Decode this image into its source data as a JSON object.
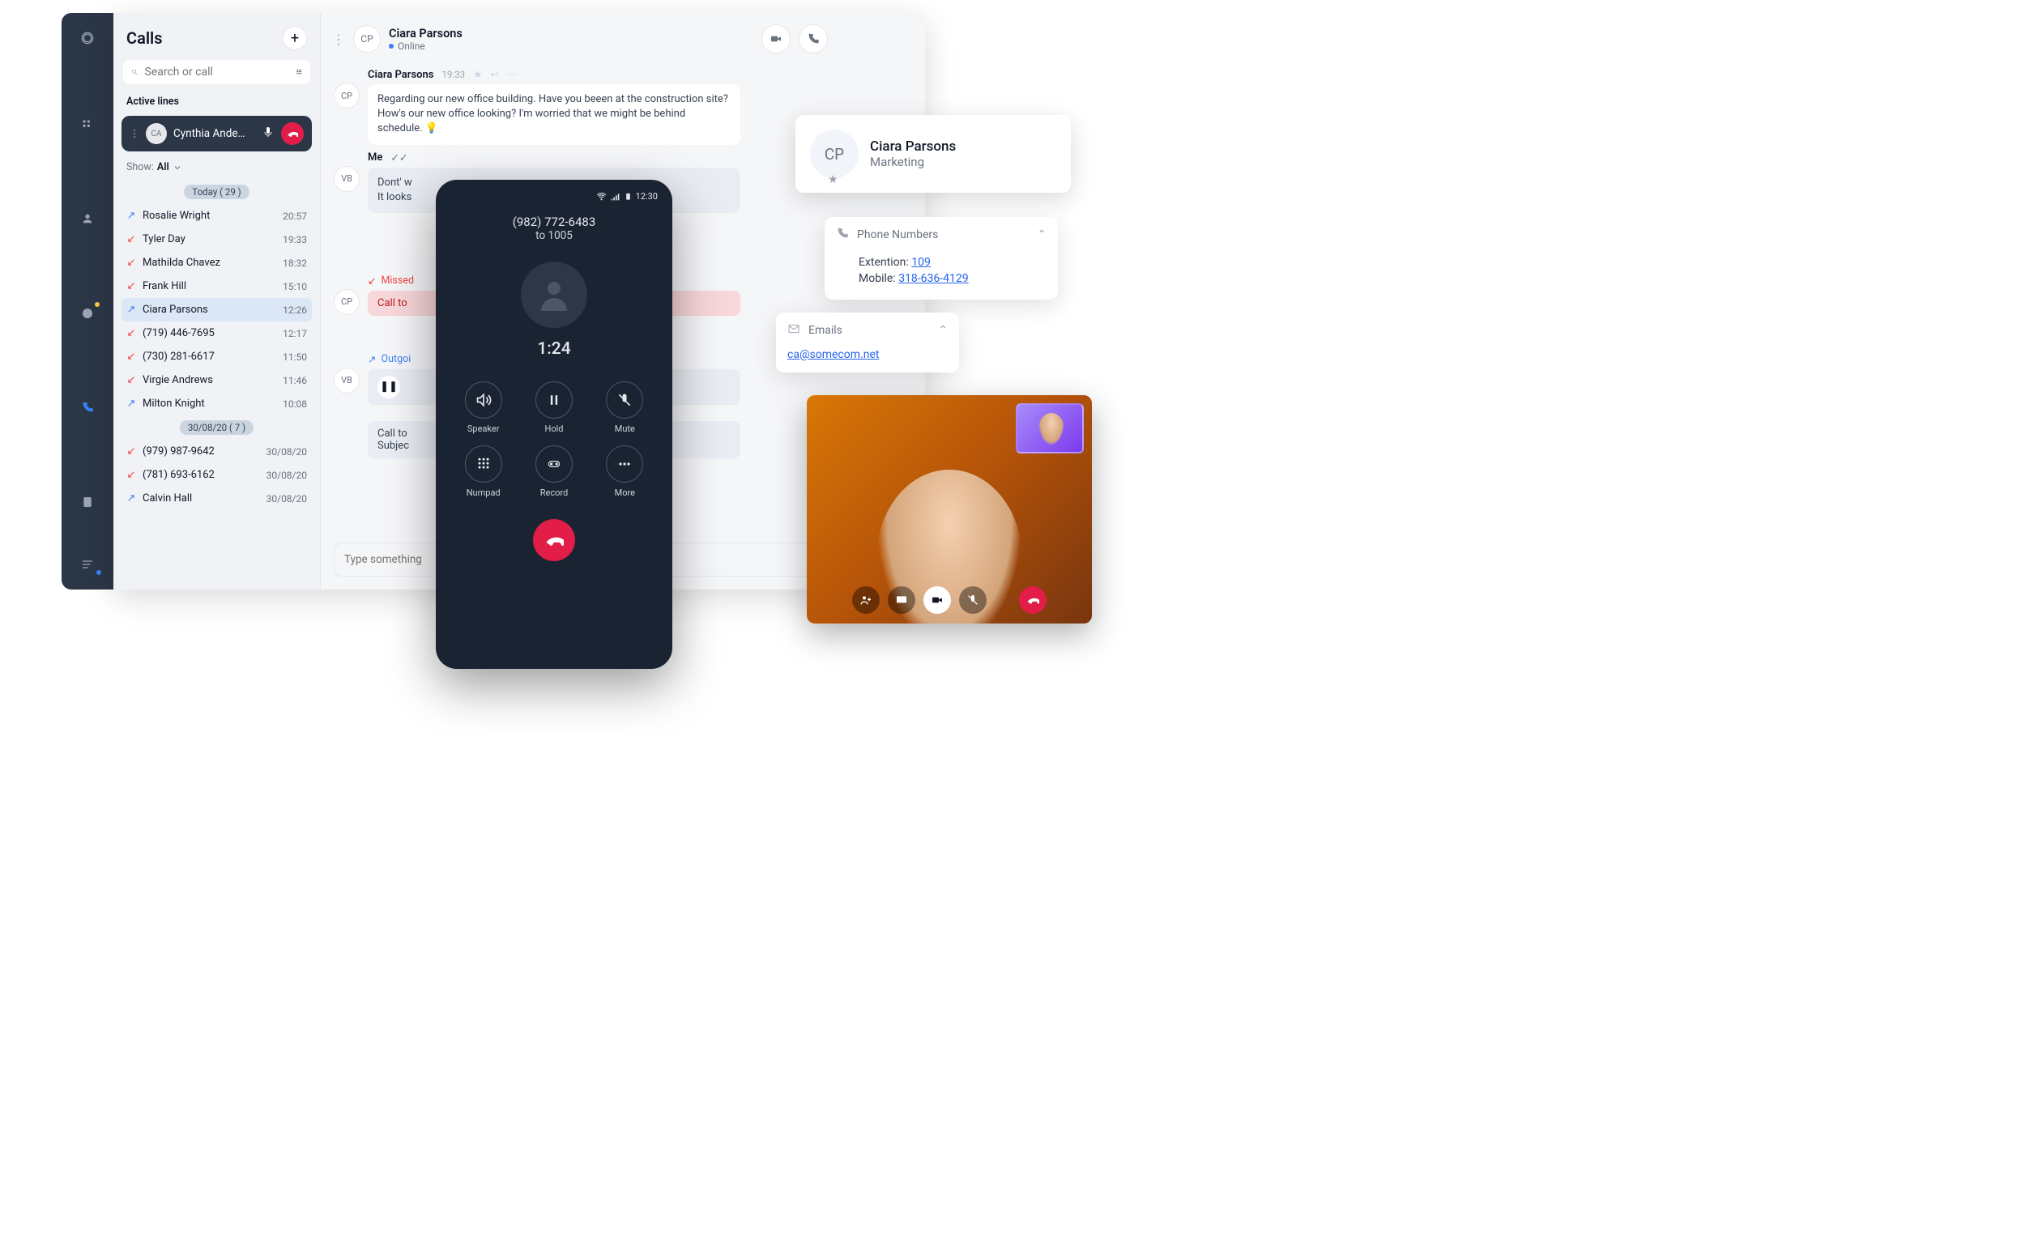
{
  "sidebar_icons": [
    "logo",
    "apps",
    "profile",
    "chat",
    "phone",
    "contacts",
    "menu"
  ],
  "calls": {
    "title": "Calls",
    "search_placeholder": "Search or call",
    "active_label": "Active lines",
    "active_name": "Cynthia Ande…",
    "active_initials": "CA",
    "filter_label": "Show:",
    "filter_value": "All",
    "today_pill": "Today ( 29 )",
    "older_pill": "30/08/20 ( 7 )",
    "today": [
      {
        "dir": "out",
        "name": "Rosalie Wright",
        "time": "20:57"
      },
      {
        "dir": "miss",
        "name": "Tyler Day",
        "time": "19:33"
      },
      {
        "dir": "miss",
        "name": "Mathilda Chavez",
        "time": "18:32"
      },
      {
        "dir": "miss",
        "name": "Frank Hill",
        "time": "15:10"
      },
      {
        "dir": "out",
        "name": "Ciara Parsons",
        "time": "12:26",
        "sel": true
      },
      {
        "dir": "miss",
        "name": "(719) 446-7695",
        "time": "12:17"
      },
      {
        "dir": "miss",
        "name": "(730) 281-6617",
        "time": "11:50"
      },
      {
        "dir": "miss",
        "name": "Virgie Andrews",
        "time": "11:46"
      },
      {
        "dir": "out",
        "name": "Milton Knight",
        "time": "10:08"
      }
    ],
    "older": [
      {
        "dir": "miss",
        "name": "(979) 987-9642",
        "time": "30/08/20"
      },
      {
        "dir": "miss",
        "name": "(781) 693-6162",
        "time": "30/08/20"
      },
      {
        "dir": "out",
        "name": "Calvin Hall",
        "time": "30/08/20"
      }
    ]
  },
  "chat": {
    "name": "Ciara Parsons",
    "initials": "CP",
    "status": "Online",
    "msg1_name": "Ciara Parsons",
    "msg1_time": "19:33",
    "msg1_text": "Regarding our new office building. Have you beeen at the construction site? How's our new office looking? I'm worried that we might be behind schedule. 💡",
    "me_label": "Me",
    "me_text": "Dont' w\nIt looks",
    "vb_initials": "VB",
    "missed_label": "Missed",
    "missed_bar": "Call to",
    "out_label": "Outgoi",
    "out_bar_1": "Call to",
    "out_bar_2": "Subjec",
    "composer_placeholder": "Type something"
  },
  "contact": {
    "initials": "CP",
    "name": "Ciara Parsons",
    "dept": "Marketing",
    "phone_title": "Phone Numbers",
    "ext_label": "Extention:",
    "ext_val": "109",
    "mob_label": "Mobile:",
    "mob_val": "318-636-4129",
    "email_title": "Emails",
    "email_val": "ca@somecom.net"
  },
  "phone": {
    "time": "12:30",
    "number": "(982) 772-6483",
    "ext": "to 1005",
    "duration": "1:24",
    "btns": [
      "Speaker",
      "Hold",
      "Mute",
      "Numpad",
      "Record",
      "More"
    ]
  }
}
